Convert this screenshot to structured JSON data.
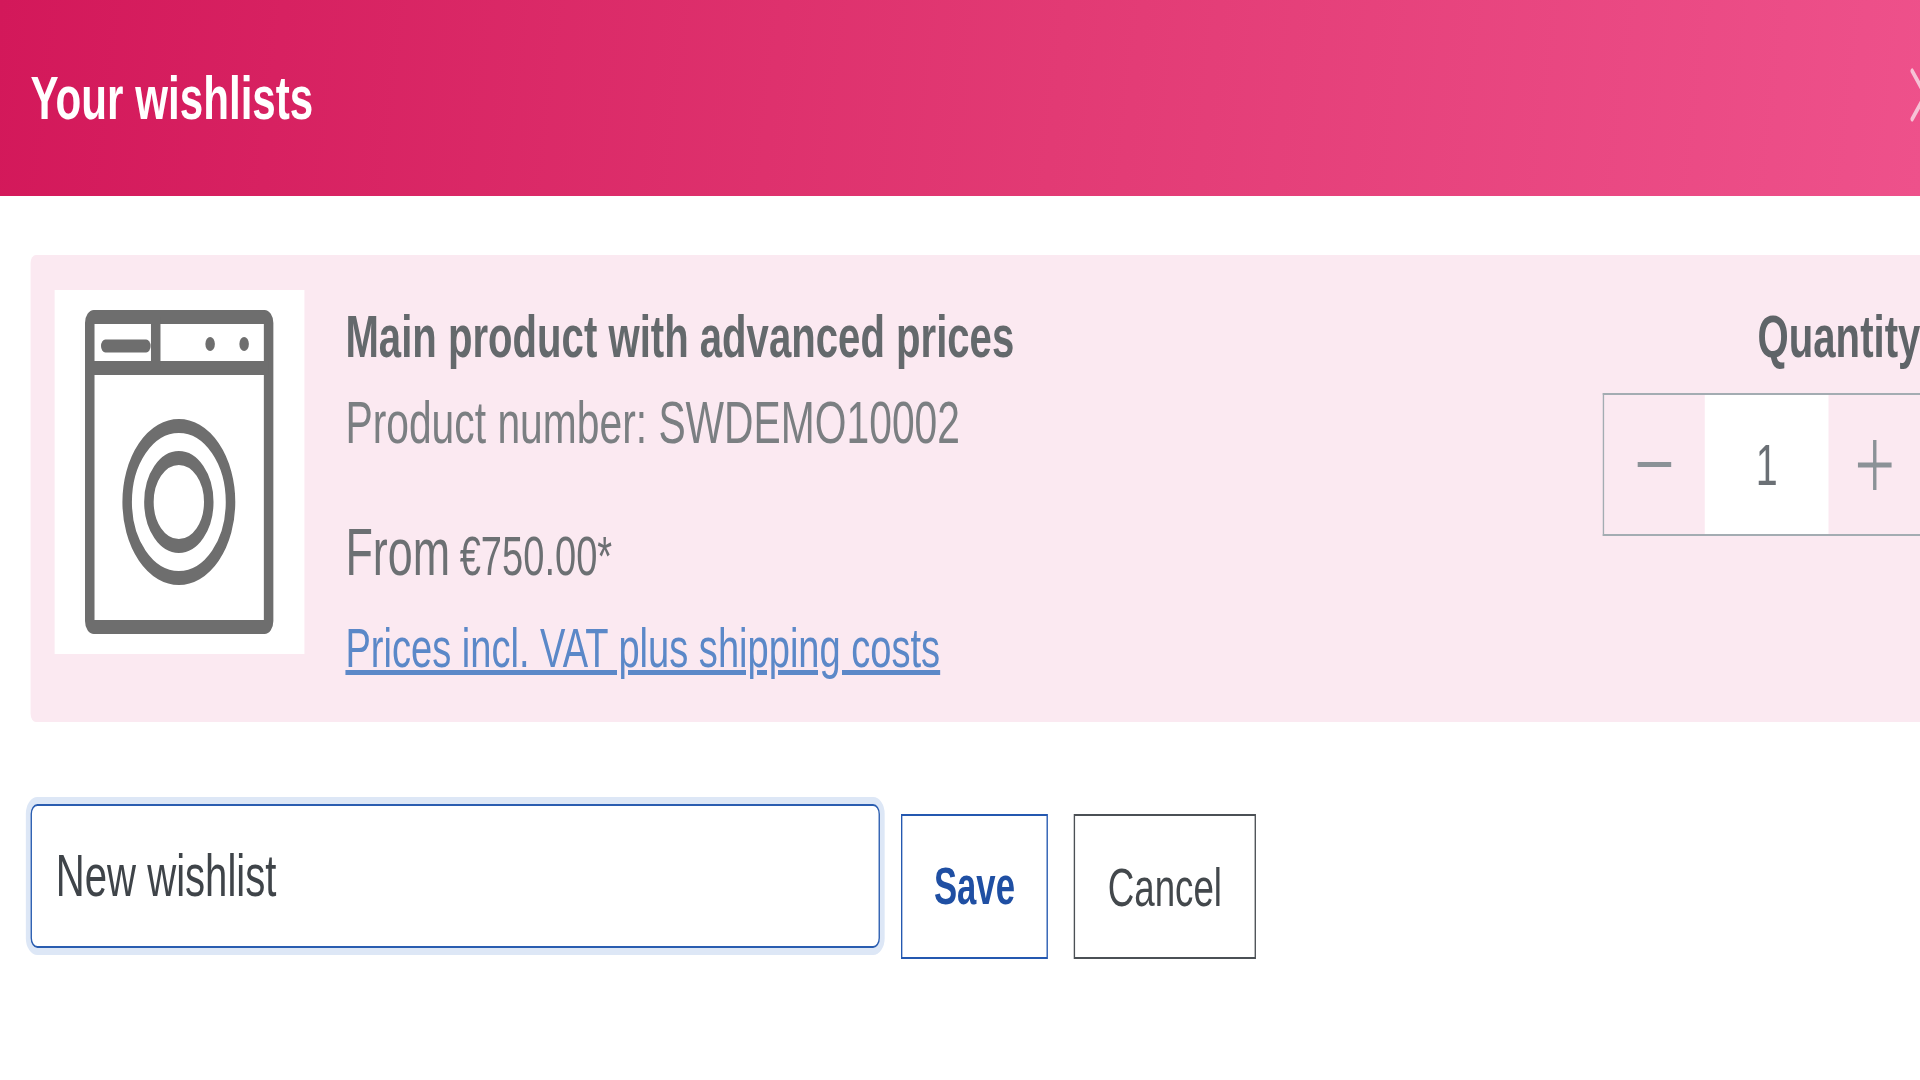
{
  "dialog": {
    "title": "Your wishlists"
  },
  "product": {
    "name": "Main product with advanced prices",
    "number": "Product number: SWDEMO10002",
    "price_prefix": "From",
    "price": "€750.00*",
    "tax_link": "Prices incl. VAT plus shipping costs"
  },
  "quantity": {
    "label": "Quantity",
    "value": "1"
  },
  "new_wishlist": {
    "value": "New wishlist",
    "focused": true
  },
  "buttons": [
    {
      "label": "Save",
      "kind": "primary"
    },
    {
      "label": "Cancel",
      "kind": "secondary"
    }
  ]
}
